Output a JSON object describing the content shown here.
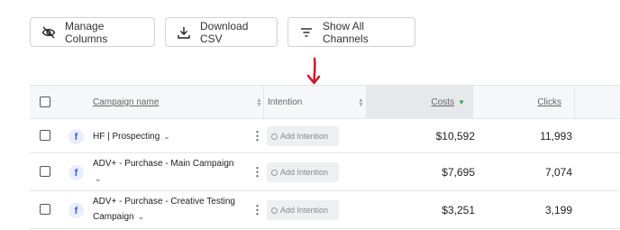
{
  "toolbar": {
    "manage_columns": "Manage Columns",
    "download_csv": "Download CSV",
    "show_all_channels": "Show All Channels"
  },
  "table": {
    "headers": {
      "campaign_name": "Campaign name",
      "intention": "Intention",
      "costs": "Costs",
      "clicks": "Clicks"
    },
    "rows": [
      {
        "channel_icon": "facebook-icon",
        "channel_letter": "f",
        "name": "HF | Prospecting",
        "intention": "Add Intention",
        "costs": "$10,592",
        "clicks": "11,993"
      },
      {
        "channel_icon": "facebook-icon",
        "channel_letter": "f",
        "name": "ADV+ - Purchase - Main Campaign",
        "intention": "Add Intention",
        "costs": "$7,695",
        "clicks": "7,074"
      },
      {
        "channel_icon": "facebook-icon",
        "channel_letter": "f",
        "name": "ADV+ - Purchase - Creative Testing Campaign",
        "intention": "Add Intention",
        "costs": "$3,251",
        "clicks": "3,199"
      }
    ]
  },
  "colors": {
    "annotation_arrow": "#d0152a",
    "sort_active": "#2eaa4a",
    "facebook_blue": "#3b5ee0"
  }
}
